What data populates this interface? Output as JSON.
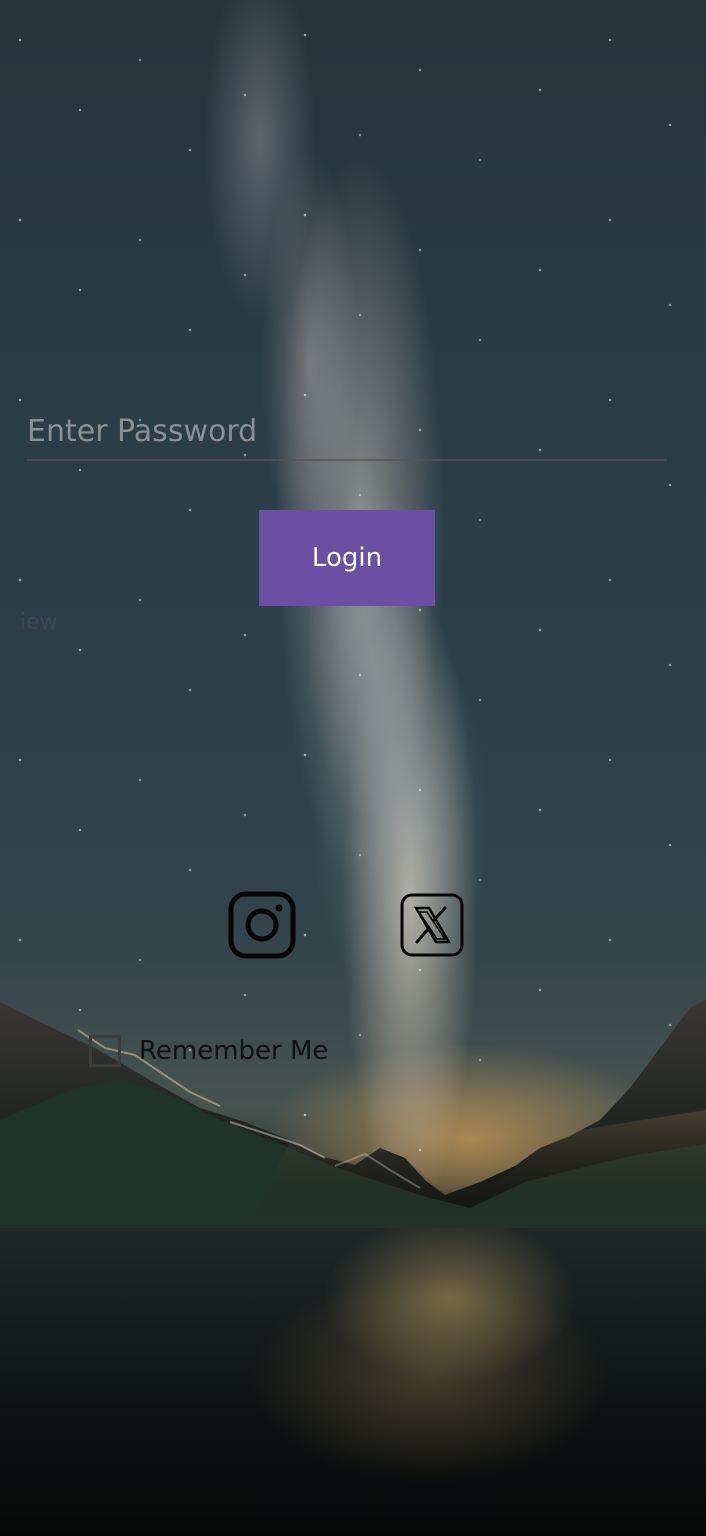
{
  "background": {
    "scene": "starry-night-sky-mountains-lake"
  },
  "login": {
    "password_placeholder": "Enter Password",
    "button_label": "Login",
    "faint_text": "iew"
  },
  "social": {
    "instagram_icon": "instagram-icon",
    "x_icon": "x-icon"
  },
  "remember": {
    "label": "Remember Me"
  },
  "colors": {
    "login_button": "#6a4fa3",
    "input_underline": "#5f5050"
  }
}
